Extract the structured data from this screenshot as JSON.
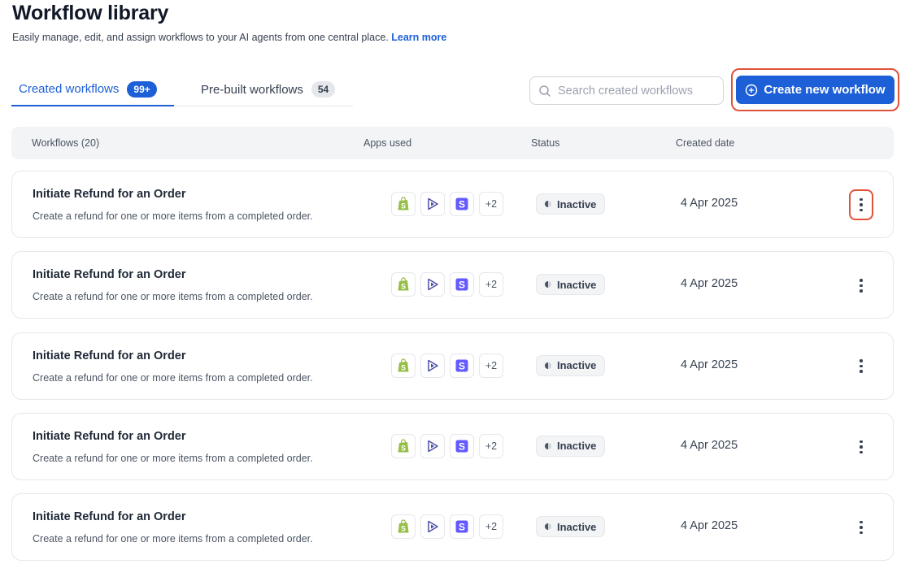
{
  "header": {
    "title": "Workflow library",
    "subtitle": "Easily manage, edit, and assign workflows to your AI agents from one central place.",
    "learn_more": "Learn more"
  },
  "tabs": [
    {
      "label": "Created workflows",
      "badge": "99+",
      "active": true
    },
    {
      "label": "Pre-built workflows",
      "badge": "54",
      "active": false
    }
  ],
  "search": {
    "placeholder": "Search created workflows"
  },
  "create_button": {
    "label": "Create new workflow"
  },
  "table": {
    "columns": [
      "Workflows (20)",
      "Apps used",
      "Status",
      "Created date"
    ],
    "rows": [
      {
        "title": "Initiate Refund for an Order",
        "description": "Create a refund for one or more items from a completed order.",
        "apps": [
          "shopify-icon",
          "play-icon",
          "stripe-icon"
        ],
        "apps_more": "+2",
        "status": "Inactive",
        "date": "4 Apr 2025"
      },
      {
        "title": "Initiate Refund for an Order",
        "description": "Create a refund for one or more items from a completed order.",
        "apps": [
          "shopify-icon",
          "play-icon",
          "stripe-icon"
        ],
        "apps_more": "+2",
        "status": "Inactive",
        "date": "4 Apr 2025"
      },
      {
        "title": "Initiate Refund for an Order",
        "description": "Create a refund for one or more items from a completed order.",
        "apps": [
          "shopify-icon",
          "play-icon",
          "stripe-icon"
        ],
        "apps_more": "+2",
        "status": "Inactive",
        "date": "4 Apr 2025"
      },
      {
        "title": "Initiate Refund for an Order",
        "description": "Create a refund for one or more items from a completed order.",
        "apps": [
          "shopify-icon",
          "play-icon",
          "stripe-icon"
        ],
        "apps_more": "+2",
        "status": "Inactive",
        "date": "4 Apr 2025"
      },
      {
        "title": "Initiate Refund for an Order",
        "description": "Create a refund for one or more items from a completed order.",
        "apps": [
          "shopify-icon",
          "play-icon",
          "stripe-icon"
        ],
        "apps_more": "+2",
        "status": "Inactive",
        "date": "4 Apr 2025"
      }
    ]
  },
  "colors": {
    "accent": "#1d5fd6",
    "highlight": "#e0523b",
    "shopify": "#95bf47",
    "stripe": "#635bff"
  }
}
